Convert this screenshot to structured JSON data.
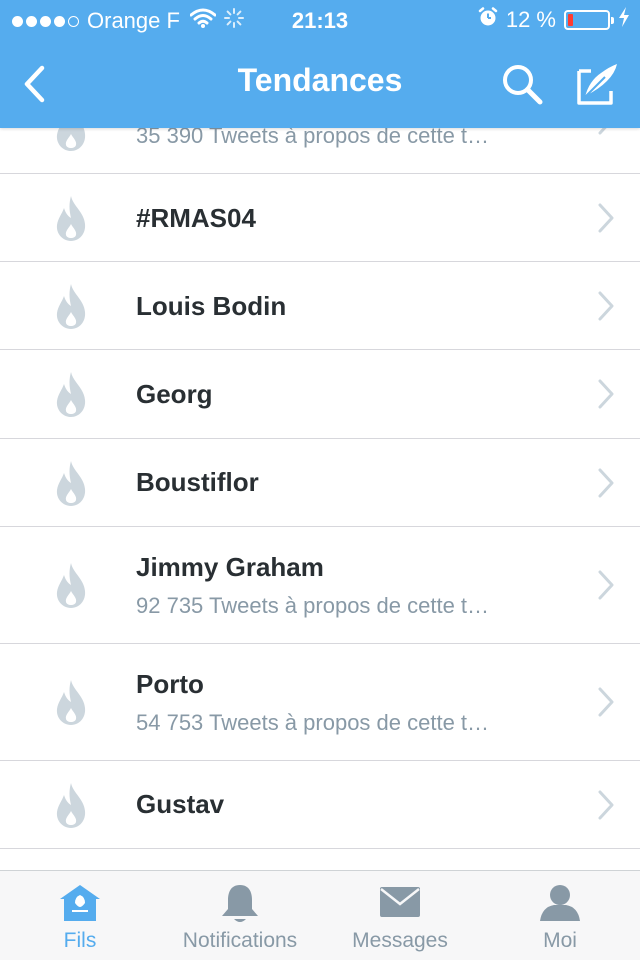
{
  "status_bar": {
    "carrier": "Orange F",
    "time": "21:13",
    "battery_percent": "12 %",
    "battery_level": 0.12,
    "signal_bars": 4,
    "signal_total": 5
  },
  "nav": {
    "title": "Tendances"
  },
  "trends": [
    {
      "name": "",
      "subtitle": "35 390 Tweets à propos de cette t…"
    },
    {
      "name": "#RMAS04",
      "subtitle": ""
    },
    {
      "name": "Louis Bodin",
      "subtitle": ""
    },
    {
      "name": "Georg",
      "subtitle": ""
    },
    {
      "name": "Boustiflor",
      "subtitle": ""
    },
    {
      "name": "Jimmy Graham",
      "subtitle": "92 735 Tweets à propos de cette t…"
    },
    {
      "name": "Porto",
      "subtitle": "54 753 Tweets à propos de cette t…"
    },
    {
      "name": "Gustav",
      "subtitle": ""
    }
  ],
  "tabs": [
    {
      "label": "Fils",
      "icon": "home-icon",
      "active": true
    },
    {
      "label": "Notifications",
      "icon": "bell-icon",
      "active": false
    },
    {
      "label": "Messages",
      "icon": "envelope-icon",
      "active": false
    },
    {
      "label": "Moi",
      "icon": "person-icon",
      "active": false
    }
  ],
  "colors": {
    "accent": "#55acee",
    "flame": "#ccd6dd",
    "chevron": "#ccd6dd",
    "text": "#292f33",
    "subtext": "#8899a6",
    "battery_low": "#ff3b30"
  }
}
